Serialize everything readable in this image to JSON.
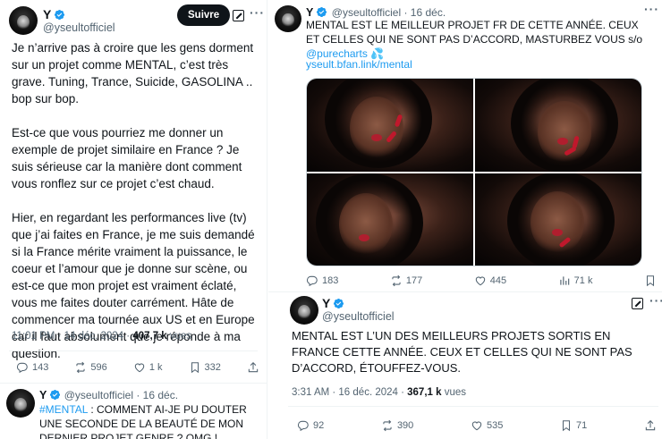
{
  "tweet_main": {
    "name": "Y",
    "handle": "@yseultofficiel",
    "follow_label": "Suivre",
    "paragraphs": [
      "Je n’arrive pas à croire que les gens dorment sur un projet comme MENTAL, c’est très grave. Tuning, Trance, Suicide, GASOLINA .. bop sur bop.",
      "Est-ce que vous pourriez me donner un exemple de projet similaire en France ? Je suis sérieuse car la manière dont comment vous ronflez sur ce projet c’est chaud.",
      "Hier, en regardant les performances live (tv) que j’ai faites en France, je me suis demandé si la France mérite vraiment la puissance, le coeur et l’amour que je donne sur scène, ou est-ce que mon projet est vraiment éclaté, vous me faites douter carrément. Hâte de commencer ma tournée aux US et en Europe car il faut absolument que je réponde à ma question."
    ],
    "time": "11:01 PM · 14 déc. 2024 · ",
    "views_count": "407,7 k",
    "views_label": " vues",
    "stats": {
      "replies": "143",
      "reposts": "596",
      "likes": "1 k",
      "bookmarks": "332"
    }
  },
  "tweet_bottom_left": {
    "name": "Y",
    "handle": "@yseultofficiel · 16 déc.",
    "hashtag": "#MENTAL",
    "text": " : COMMENT AI-JE PU DOUTER UNE SECONDE DE LA BEAUTÉ DE MON DERNIER PROJET GENRE ? OMG !"
  },
  "tweet_top_right": {
    "name": "Y",
    "handle": "@yseultofficiel · 16 déc.",
    "text": "MENTAL EST LE MEILLEUR PROJET FR DE CETTE ANNÉE. CEUX ET CELLES QUI NE SONT PAS D’ACCORD, MASTURBEZ VOUS s/o ",
    "mention": "@purecharts",
    "emoji": "💦",
    "url": "yseult.bfan.link/mental",
    "stats": {
      "replies": "183",
      "reposts": "177",
      "likes": "445",
      "views": "71 k"
    }
  },
  "tweet_bottom_right": {
    "name": "Y",
    "handle": "@yseultofficiel",
    "text": "MENTAL EST L’UN DES MEILLEURS PROJETS SORTIS EN FRANCE CETTE ANNÉE. CEUX ET CELLES QUI NE SONT PAS D’ACCORD, ÉTOUFFEZ-VOUS.",
    "time": "3:31 AM · 16 déc. 2024 · ",
    "views_count": "367,1 k",
    "views_label": " vues",
    "stats": {
      "replies": "92",
      "reposts": "390",
      "likes": "535",
      "bookmarks": "71"
    }
  },
  "colors": {
    "link": "#1d9bf0",
    "verified": "#1d9bf0",
    "text": "#0f1419",
    "muted": "#536471"
  },
  "icons": [
    "verified-badge-icon",
    "grok-icon",
    "more-icon",
    "reply-icon",
    "repost-icon",
    "like-icon",
    "bookmark-icon",
    "share-icon",
    "views-icon"
  ]
}
